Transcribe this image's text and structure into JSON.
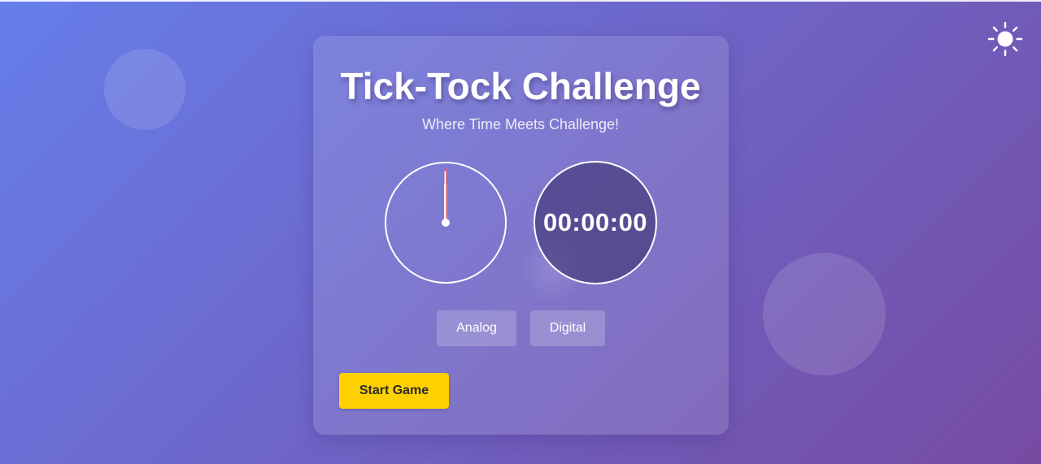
{
  "header": {
    "title": "Tick-Tock Challenge",
    "subtitle": "Where Time Meets Challenge!"
  },
  "theme_toggle": {
    "icon": "sun-icon"
  },
  "clocks": {
    "analog": {
      "icon": "analog-clock-icon"
    },
    "digital": {
      "time": "00:00:00"
    }
  },
  "mode_buttons": {
    "analog_label": "Analog",
    "digital_label": "Digital"
  },
  "actions": {
    "start_label": "Start Game"
  },
  "colors": {
    "background_start": "#667eea",
    "background_end": "#764ba2",
    "start_button": "#ffd100",
    "second_hand": "#e05a6a"
  }
}
